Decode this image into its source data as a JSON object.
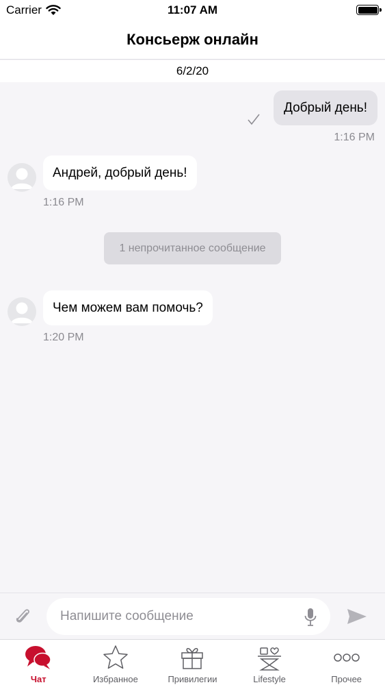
{
  "status_bar": {
    "carrier": "Carrier",
    "time": "11:07 AM"
  },
  "header": {
    "title": "Консьерж онлайн"
  },
  "date_separator": "6/2/20",
  "messages": [
    {
      "direction": "outgoing",
      "text": "Добрый день!",
      "time": "1:16 PM",
      "status_icon": "check-icon"
    },
    {
      "direction": "incoming",
      "text": "Андрей, добрый день!",
      "time": "1:16 PM",
      "avatar_icon": "avatar-placeholder"
    },
    {
      "direction": "incoming",
      "text": "Чем можем вам помочь?",
      "time": "1:20 PM",
      "avatar_icon": "avatar-placeholder"
    }
  ],
  "unread_banner": "1 непрочитанное сообщение",
  "composer": {
    "placeholder": "Напишите сообщение",
    "attach_icon": "paperclip-icon",
    "mic_icon": "microphone-icon",
    "send_icon": "send-icon"
  },
  "tabs": [
    {
      "label": "Чат",
      "icon": "chat-bubbles-icon",
      "active": true
    },
    {
      "label": "Избранное",
      "icon": "star-icon",
      "active": false
    },
    {
      "label": "Привилегии",
      "icon": "gift-icon",
      "active": false
    },
    {
      "label": "Lifestyle",
      "icon": "lifestyle-icon",
      "active": false
    },
    {
      "label": "Прочее",
      "icon": "more-dots-icon",
      "active": false
    }
  ],
  "colors": {
    "accent": "#c7102e",
    "background": "#f6f5f8",
    "outgoing_bubble": "#e4e3e8",
    "incoming_bubble": "#ffffff"
  }
}
